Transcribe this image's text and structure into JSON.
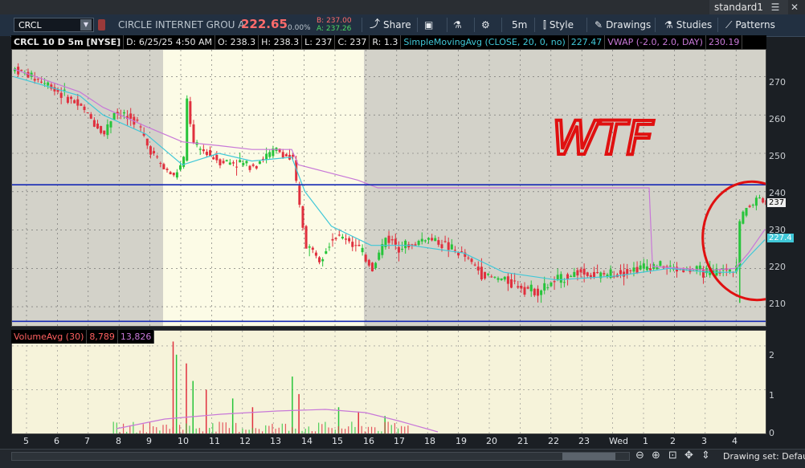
{
  "workspace": {
    "name": "standard1",
    "menu_icon": "hamburger-icon",
    "close_icon": "close-icon"
  },
  "toolbar": {
    "symbol": "CRCL",
    "company": "CIRCLE INTERNET GROU A",
    "last": "222.65",
    "pct": "0.00%",
    "bid": "B: 237.00",
    "ask": "A: 237.26",
    "buttons": {
      "share": "Share",
      "timeframe": "5m",
      "style": "Style",
      "drawings": "Drawings",
      "studies": "Studies",
      "patterns": "Patterns"
    }
  },
  "infobar": {
    "symbol": "CRCL 10 D 5m [NYSE]",
    "date": "D: 6/25/25 4:50 AM",
    "open": "O: 238.3",
    "high": "H: 238.3",
    "low": "L: 237",
    "close": "C: 237",
    "range": "R: 1.3",
    "sma": "SimpleMovingAvg (CLOSE, 20, 0, no)",
    "sma_val": "227.47",
    "vwap": "VWAP (-2.0, 2.0, DAY)",
    "vwap_val": "230.19"
  },
  "colors": {
    "up": "#27c43a",
    "down": "#e0303e",
    "sma": "#40c8d8",
    "vwap": "#c878d8",
    "hline": "#1428b4",
    "annotation": "#e01010"
  },
  "annotation_text": "WTF",
  "price_scale": {
    "ticks": [
      "270",
      "260",
      "250",
      "240",
      "230",
      "220",
      "210"
    ],
    "marker_sma": "227.4",
    "marker_last": "237"
  },
  "volume": {
    "label": "VolumeAvg (30)",
    "value": "8,789",
    "avg": "13,826",
    "ticks": [
      "2",
      "1",
      "0"
    ]
  },
  "axis_labels": [
    "5",
    "6",
    "7",
    "8",
    "9",
    "10",
    "11",
    "12",
    "13",
    "14",
    "15",
    "16",
    "17",
    "18",
    "19",
    "20",
    "21",
    "22",
    "23",
    "Wed",
    "1",
    "2",
    "3",
    "4"
  ],
  "bottom": {
    "drawing_set": "Drawing set: Default"
  },
  "chart_data": {
    "type": "candlestick",
    "ylim": [
      205,
      277
    ],
    "close_profile": [
      [
        0,
        272
      ],
      [
        10,
        268
      ],
      [
        20,
        262
      ],
      [
        27,
        255
      ],
      [
        30,
        261
      ],
      [
        37,
        258
      ],
      [
        40,
        252
      ],
      [
        45,
        246
      ],
      [
        48,
        244
      ],
      [
        51,
        248
      ],
      [
        52,
        264
      ],
      [
        54,
        252
      ],
      [
        62,
        248
      ],
      [
        72,
        247
      ],
      [
        79,
        251
      ],
      [
        84,
        248
      ],
      [
        86,
        236
      ],
      [
        88,
        226
      ],
      [
        92,
        223
      ],
      [
        96,
        228
      ],
      [
        100,
        228
      ],
      [
        104,
        225
      ],
      [
        108,
        220
      ],
      [
        112,
        228
      ],
      [
        116,
        226
      ],
      [
        120,
        226
      ],
      [
        124,
        228
      ],
      [
        128,
        227
      ],
      [
        136,
        223
      ],
      [
        142,
        218
      ],
      [
        148,
        217
      ],
      [
        154,
        215
      ],
      [
        158,
        214
      ],
      [
        164,
        217
      ],
      [
        170,
        219
      ],
      [
        176,
        218
      ],
      [
        182,
        219
      ],
      [
        188,
        220
      ],
      [
        194,
        221
      ],
      [
        198,
        220
      ],
      [
        204,
        219.5
      ],
      [
        210,
        219
      ],
      [
        216,
        219.5
      ],
      [
        218,
        221
      ],
      [
        219,
        232
      ],
      [
        221,
        236
      ],
      [
        223,
        237
      ],
      [
        225,
        239
      ],
      [
        226,
        238
      ],
      [
        227,
        237
      ]
    ],
    "sma_profile": [
      [
        0,
        270
      ],
      [
        20,
        265
      ],
      [
        27,
        260
      ],
      [
        40,
        255
      ],
      [
        51,
        247
      ],
      [
        62,
        250
      ],
      [
        72,
        248
      ],
      [
        84,
        249
      ],
      [
        88,
        240
      ],
      [
        96,
        231
      ],
      [
        108,
        226
      ],
      [
        120,
        226
      ],
      [
        136,
        224
      ],
      [
        148,
        219
      ],
      [
        164,
        217
      ],
      [
        182,
        218
      ],
      [
        198,
        220
      ],
      [
        210,
        219
      ],
      [
        218,
        219
      ],
      [
        222,
        223
      ],
      [
        227,
        227.47
      ]
    ],
    "vwap_profile": [
      [
        0,
        272
      ],
      [
        20,
        266
      ],
      [
        27,
        262
      ],
      [
        40,
        257
      ],
      [
        51,
        253
      ],
      [
        62,
        252
      ],
      [
        72,
        251
      ],
      [
        84,
        251
      ],
      [
        86,
        247
      ],
      [
        104,
        243
      ],
      [
        110,
        241
      ],
      [
        192,
        241
      ],
      [
        193,
        220.5
      ],
      [
        210,
        219.5
      ],
      [
        218,
        220
      ],
      [
        222,
        224
      ],
      [
        227,
        230.19
      ]
    ],
    "blue_lines": [
      241.8,
      206.2
    ],
    "volume_bars": [
      [
        48,
        2.1
      ],
      [
        49,
        1.8
      ],
      [
        52,
        1.6
      ],
      [
        54,
        1.2
      ],
      [
        58,
        1.0
      ],
      [
        66,
        0.8
      ],
      [
        72,
        0.6
      ],
      [
        84,
        1.3
      ],
      [
        86,
        0.9
      ],
      [
        98,
        0.6
      ],
      [
        104,
        0.5
      ],
      [
        112,
        0.4
      ]
    ],
    "volume_ylim": [
      0,
      2.2
    ]
  }
}
